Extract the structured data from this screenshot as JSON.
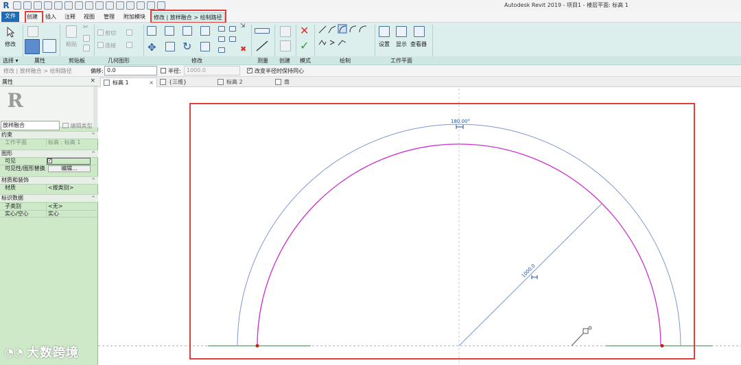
{
  "window": {
    "title": "Autodesk Revit 2019 - 项目1 - 楼层平面: 标高 1"
  },
  "tabs": [
    {
      "label": "文件"
    },
    {
      "label": "创建"
    },
    {
      "label": "插入"
    },
    {
      "label": "注释"
    },
    {
      "label": "视图"
    },
    {
      "label": "管理"
    },
    {
      "label": "附加模块"
    },
    {
      "label": "修改 | 放样融合 > 绘制路径"
    }
  ],
  "ribbon": {
    "modify_label": "修改",
    "panels": [
      "选择 ▾",
      "属性",
      "剪贴板",
      "几何图形",
      "修改",
      "测量",
      "创建",
      "模式",
      "绘制",
      "工作平面"
    ],
    "clipboard": {
      "paste": "粘贴"
    },
    "geometry": {
      "cut": "剪切",
      "join": "连接"
    },
    "workplane": {
      "set": "设置",
      "show": "显示",
      "viewer": "查看器"
    },
    "colors": {
      "accent": "#1e6bb8",
      "ribbon_bg": "#dcefec",
      "cancel": "#d93030",
      "finish": "#2e9a3a"
    }
  },
  "options_bar": {
    "breadcrumb": "修改 | 放样融合 > 绘制路径",
    "offset_label": "偏移:",
    "offset_value": "0.0",
    "radius_label": "半径:",
    "radius_value": "1000.0",
    "keep_concentric_label": "改变半径时保持同心"
  },
  "properties": {
    "title": "属性",
    "close": "×",
    "type_name": "放样融合",
    "edit_type": "编辑类型",
    "sections": {
      "constraints": "约束",
      "graphics": "图形",
      "materials": "材质和装饰",
      "identity": "标识数据"
    },
    "rows": {
      "workplane_key": "工作平面",
      "workplane_val": "标高 : 标高 1",
      "visible_key": "可见",
      "visibility_key": "可见性/图形替换",
      "visibility_btn": "编辑...",
      "material_key": "材质",
      "material_val": "<按类别>",
      "subcategory_key": "子类别",
      "subcategory_val": "<无>",
      "solid_key": "实心/空心",
      "solid_val": "实心"
    }
  },
  "view_tabs": [
    {
      "label": "标高 1",
      "close": "×"
    },
    {
      "label": "{三维}"
    },
    {
      "label": "标高 2"
    },
    {
      "label": "南"
    }
  ],
  "canvas": {
    "angle_label": "180.00°",
    "radius_label": "1000.0",
    "colors": {
      "arc_outer": "#7a95d4",
      "arc_inner": "#cc2ecc",
      "highlight": "#e33c3c",
      "baseline": "#2a8a3a"
    }
  },
  "watermark": {
    "text": "大数跨境"
  }
}
